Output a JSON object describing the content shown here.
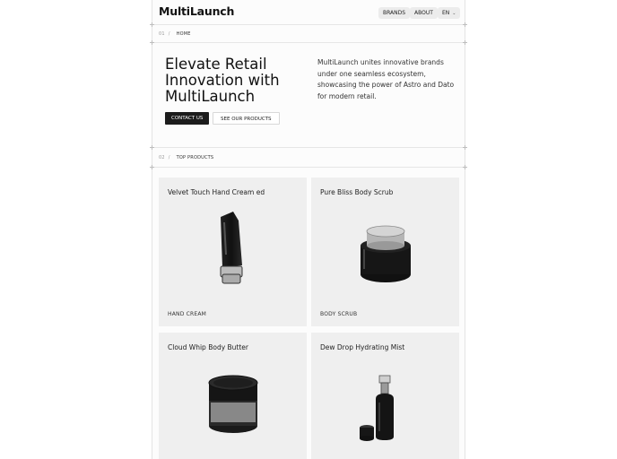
{
  "header": {
    "logo": "MultiLaunch",
    "nav": {
      "brands": "BRANDS",
      "about": "ABOUT",
      "language": "EN"
    }
  },
  "breadcrumb_home": {
    "index": "01",
    "slash": "/",
    "label": "HOME"
  },
  "hero": {
    "title": "Elevate Retail Innovation with MultiLaunch",
    "description": "MultiLaunch unites innovative brands under one seamless ecosystem, showcasing the power of Astro and Dato for modern retail.",
    "primary_button": "CONTACT US",
    "secondary_button": "SEE OUR PRODUCTS"
  },
  "breadcrumb_products": {
    "index": "02",
    "slash": "/",
    "label": "TOP  PRODUCTS"
  },
  "products": [
    {
      "name": "Velvet Touch Hand Cream ed",
      "category": "HAND CREAM",
      "icon": "hand-cream-tube-icon"
    },
    {
      "name": "Pure Bliss Body Scrub",
      "category": "BODY SCRUB",
      "icon": "body-scrub-jar-icon"
    },
    {
      "name": "Cloud Whip Body Butter",
      "category": "",
      "icon": "body-butter-tin-icon"
    },
    {
      "name": "Dew Drop Hydrating Mist",
      "category": "",
      "icon": "mist-spray-bottle-icon"
    }
  ]
}
